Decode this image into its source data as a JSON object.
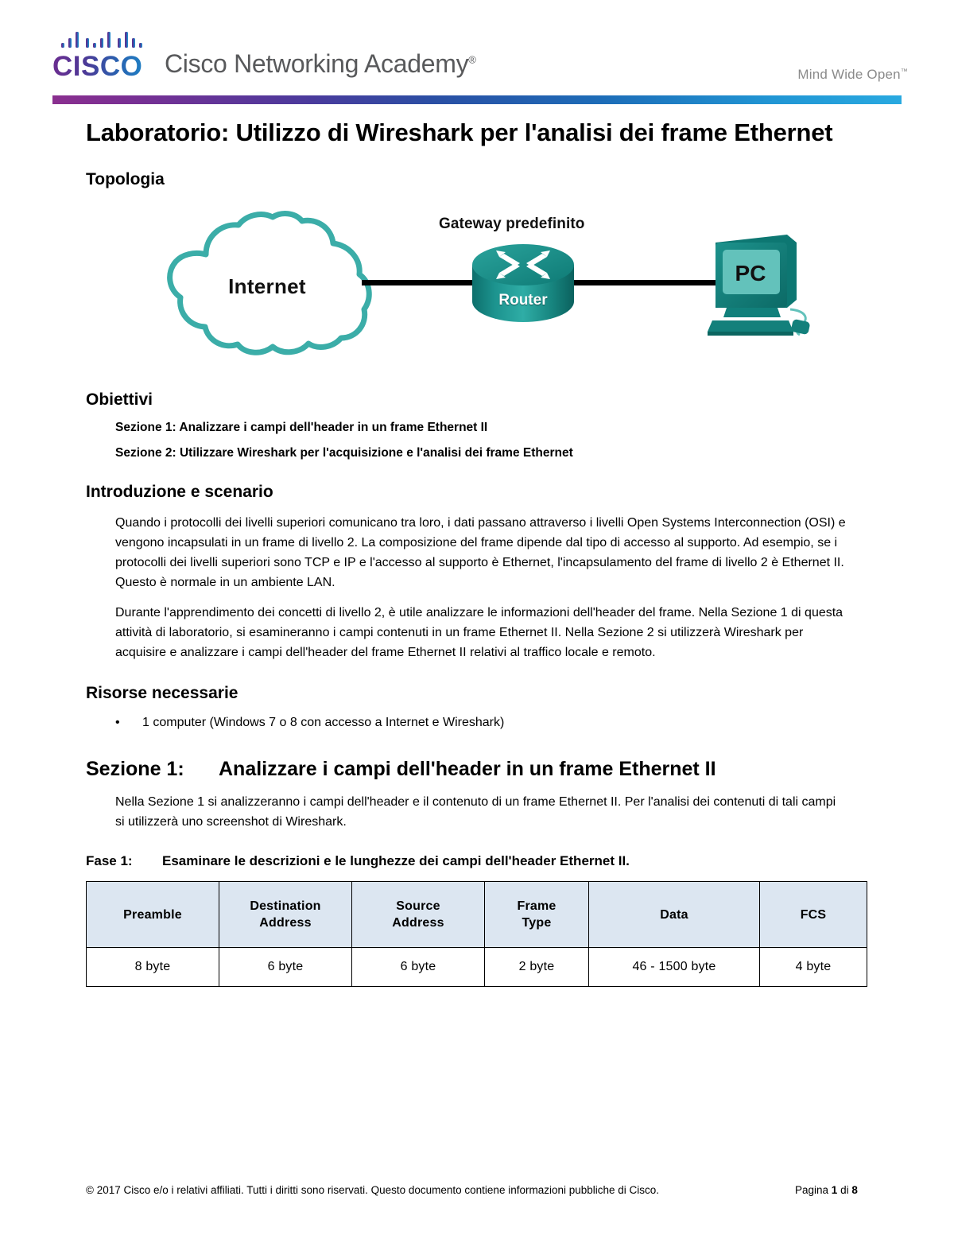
{
  "header": {
    "logo_text": "CISCO",
    "logo_dot": ".",
    "brand": "Cisco Networking Academy",
    "brand_tm": "®",
    "tagline": "Mind Wide Open",
    "tagline_tm": "™",
    "colors": {
      "rule_start": "#8a2f8f",
      "rule_mid": "#2a4fa4",
      "rule_end": "#29a9e0"
    }
  },
  "document": {
    "title": "Laboratorio: Utilizzo di Wireshark per l'analisi dei frame Ethernet"
  },
  "topology": {
    "heading": "Topologia",
    "cloud_label": "Internet",
    "gateway_label": "Gateway predefinito",
    "router_label": "Router",
    "pc_label": "PC",
    "device_color": "#17918c",
    "cloud_color": "#3bada8"
  },
  "objectives": {
    "heading": "Obiettivi",
    "items": [
      "Sezione 1: Analizzare i campi dell'header in un frame Ethernet II",
      "Sezione 2: Utilizzare Wireshark per l'acquisizione e l'analisi dei frame Ethernet"
    ]
  },
  "introduction": {
    "heading": "Introduzione e scenario",
    "paragraphs": [
      "Quando i protocolli dei livelli superiori comunicano tra loro, i dati passano attraverso i livelli Open Systems Interconnection (OSI) e vengono incapsulati in un frame di livello 2. La composizione del frame dipende dal tipo di accesso al supporto. Ad esempio, se i protocolli dei livelli superiori sono TCP e IP e l'accesso al supporto è Ethernet, l'incapsulamento del frame di livello 2 è Ethernet II. Questo è normale in un ambiente LAN.",
      "Durante l'apprendimento dei concetti di livello 2, è utile analizzare le informazioni dell'header del frame. Nella Sezione 1 di questa attività di laboratorio, si esamineranno i campi contenuti in un frame Ethernet II. Nella Sezione 2 si utilizzerà Wireshark per acquisire e analizzare i campi dell'header del frame Ethernet II relativi al traffico locale e remoto."
    ]
  },
  "resources": {
    "heading": "Risorse necessarie",
    "bullet": "•",
    "items": [
      "1 computer (Windows 7 o 8 con accesso a Internet e Wireshark)"
    ]
  },
  "section1": {
    "label": "Sezione 1:",
    "title": "Analizzare i campi dell'header in un frame Ethernet II",
    "paragraph": "Nella Sezione 1 si analizzeranno i campi dell'header e il contenuto di un frame Ethernet II. Per l'analisi dei contenuti di tali campi si utilizzerà uno screenshot di Wireshark.",
    "step": {
      "label": "Fase 1:",
      "title": "Esaminare le descrizioni e le lunghezze dei campi dell'header Ethernet II."
    }
  },
  "frame_table": {
    "headers": [
      "Preamble",
      "Destination Address",
      "Source Address",
      "Frame Type",
      "Data",
      "FCS"
    ],
    "headers_lines": [
      [
        "Preamble"
      ],
      [
        "Destination",
        "Address"
      ],
      [
        "Source",
        "Address"
      ],
      [
        "Frame",
        "Type"
      ],
      [
        "Data"
      ],
      [
        "FCS"
      ]
    ],
    "values": [
      "8 byte",
      "6 byte",
      "6 byte",
      "2 byte",
      "46 - 1500 byte",
      "4 byte"
    ],
    "header_bg": "#dce6f1"
  },
  "footer": {
    "copyright": "© 2017 Cisco e/o i relativi affiliati. Tutti i diritti sono riservati. Questo documento contiene informazioni pubbliche di Cisco.",
    "page_prefix": "Pagina ",
    "page_number": "1",
    "page_middle": " di ",
    "page_total": "8"
  }
}
